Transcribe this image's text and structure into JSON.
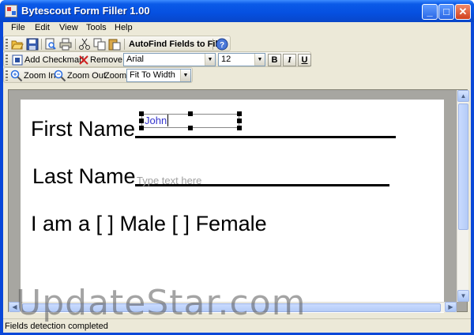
{
  "window": {
    "title": "Bytescout Form Filler 1.00",
    "minimize": "_",
    "maximize": "□",
    "close": "✕"
  },
  "menu": {
    "items": [
      "File",
      "Edit",
      "View",
      "Tools",
      "Help"
    ]
  },
  "toolbar1": {
    "autofind_label": "AutoFind Fields to Fill"
  },
  "toolbar2": {
    "add_checkmark_label": "Add Checkmark",
    "remove_label": "Remove",
    "font_value": "Arial",
    "size_value": "12",
    "bold": "B",
    "italic": "I",
    "underline": "U"
  },
  "toolbar3": {
    "zoom_in_label": "Zoom In",
    "zoom_out_label": "Zoom Out",
    "zoom_label": "Zoom:",
    "zoom_value": "Fit To Width"
  },
  "document": {
    "first_name_label": "First Name",
    "first_name_value": "John",
    "last_name_label": "Last Name",
    "last_name_placeholder": "Type text here",
    "gender_line": "I am a [  ] Male [  ] Female"
  },
  "status": {
    "text": "Fields detection completed"
  },
  "watermark": "UpdateStar.com",
  "colors": {
    "titlebar": "#0a5ae8",
    "field_text": "#3333cc",
    "chrome": "#ece9d8"
  }
}
